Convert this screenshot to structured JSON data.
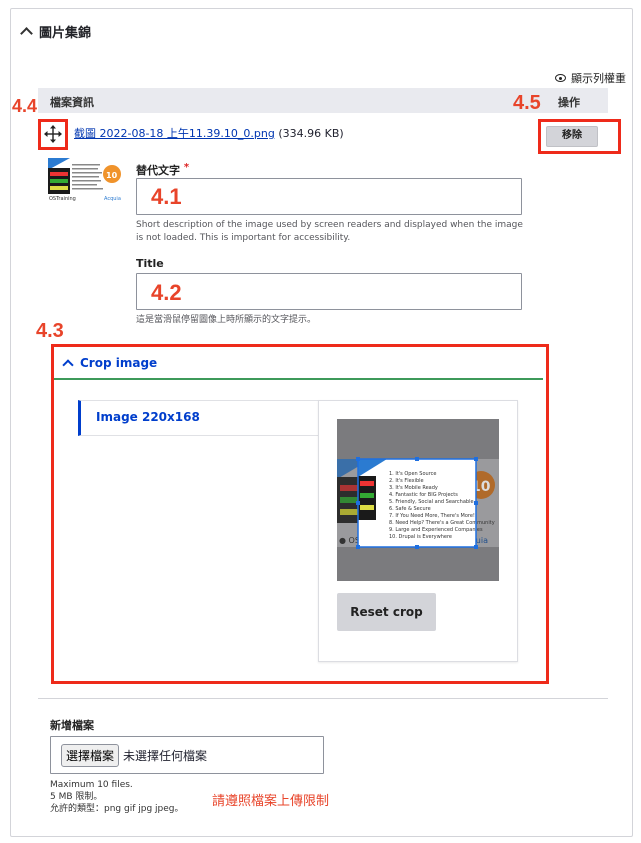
{
  "section": {
    "title": "圖片集錦"
  },
  "toolbar": {
    "show_weights": "顯示列權重"
  },
  "table": {
    "col_file": "檔案資訊",
    "col_ops": "操作"
  },
  "file": {
    "name": "截圖 2022-08-18 上午11.39.10_0.png",
    "size": "(334.96 KB)",
    "remove_label": "移除"
  },
  "alt": {
    "label": "替代文字",
    "required_mark": "*",
    "value": "",
    "help": "Short description of the image used by screen readers and displayed when the image is not loaded. This is important for accessibility."
  },
  "title_field": {
    "label": "Title",
    "value": "",
    "help": "這是當滑鼠停留圖像上時所顯示的文字提示。"
  },
  "crop": {
    "header": "Crop image",
    "tab_label": "Image 220x168",
    "reset_label": "Reset crop"
  },
  "preview": {
    "brand": "Drupal",
    "badge": "Top 10",
    "list": [
      "1. It's Open Source",
      "2. It's Flexible",
      "3. It's Mobile Ready",
      "4. Fantastic for BIG Projects",
      "5. Friendly, Social and Searchable",
      "6. Safe & Secure",
      "7. If You Need More, There's More!",
      "8. Need Help? There's a Great Community",
      "9. Large and Experienced Companies",
      "10. Drupal is Everywhere"
    ],
    "footer_left": "OSTraining",
    "footer_right": "Acquia"
  },
  "upload": {
    "label": "新增檔案",
    "button_label": "選擇檔案",
    "no_file": "未選擇任何檔案",
    "limit_count": "Maximum 10 files.",
    "limit_size": "5 MB 限制。",
    "limit_types": "允許的類型：png gif jpg jpeg。",
    "note": "請遵照檔案上傳限制"
  },
  "annotations": {
    "a41": "4.1",
    "a42": "4.2",
    "a43": "4.3",
    "a44": "4.4",
    "a45": "4.5"
  },
  "colors": {
    "accent": "#003ecc",
    "annotation_red": "#ee2a1a",
    "green_border": "#3d9a5a"
  }
}
